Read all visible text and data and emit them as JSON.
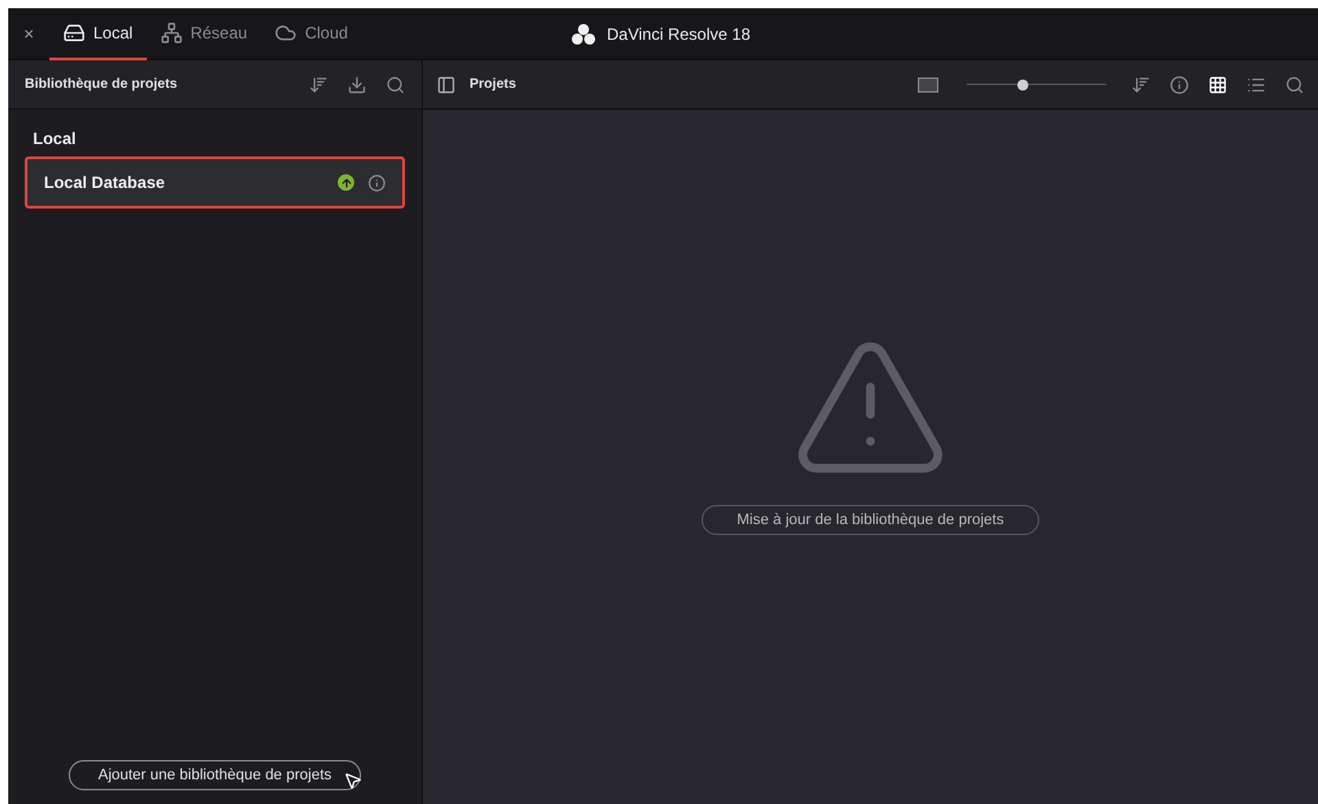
{
  "window": {
    "title": "DaVinci Resolve 18",
    "close": "×"
  },
  "tabs": [
    {
      "label": "Local",
      "selected": true,
      "kind": "drive"
    },
    {
      "label": "Réseau",
      "selected": false,
      "kind": "network"
    },
    {
      "label": "Cloud",
      "selected": false,
      "kind": "cloud"
    }
  ],
  "sidebar": {
    "title": "Bibliothèque de projets",
    "group": "Local",
    "items": [
      {
        "label": "Local Database",
        "selected": true
      }
    ],
    "add_button": "Ajouter une bibliothèque de projets"
  },
  "main": {
    "title": "Projets",
    "zoom": {
      "level": 0.4
    },
    "view_modes": [
      {
        "kind": "grid",
        "selected": true
      },
      {
        "kind": "list",
        "selected": false
      }
    ],
    "update_button": "Mise à jour de la bibliothèque de projets"
  }
}
